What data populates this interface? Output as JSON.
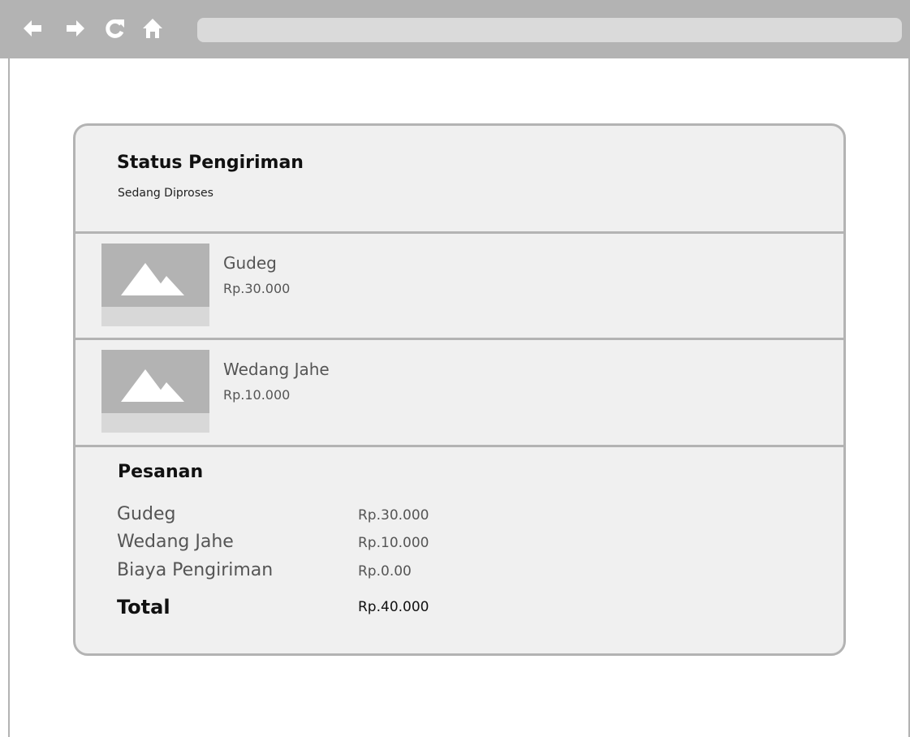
{
  "browser": {
    "icons": [
      "back-arrow-icon",
      "forward-arrow-icon",
      "reload-icon",
      "home-icon"
    ]
  },
  "status": {
    "title": "Status Pengiriman",
    "value": "Sedang Diproses"
  },
  "items": [
    {
      "name": "Gudeg",
      "price": "Rp.30.000",
      "icon": "image-placeholder-icon"
    },
    {
      "name": "Wedang Jahe",
      "price": "Rp.10.000",
      "icon": "image-placeholder-icon"
    }
  ],
  "order": {
    "title": "Pesanan",
    "lines": [
      {
        "label": "Gudeg",
        "value": "Rp.30.000"
      },
      {
        "label": "Wedang Jahe",
        "value": "Rp.10.000"
      },
      {
        "label": "Biaya Pengiriman",
        "value": "Rp.0.00"
      }
    ],
    "total_label": "Total",
    "total_value": "Rp.40.000"
  },
  "colors": {
    "chrome": "#b3b3b3",
    "card_background": "#f0f0f0",
    "placeholder": "#d8d8d8"
  }
}
